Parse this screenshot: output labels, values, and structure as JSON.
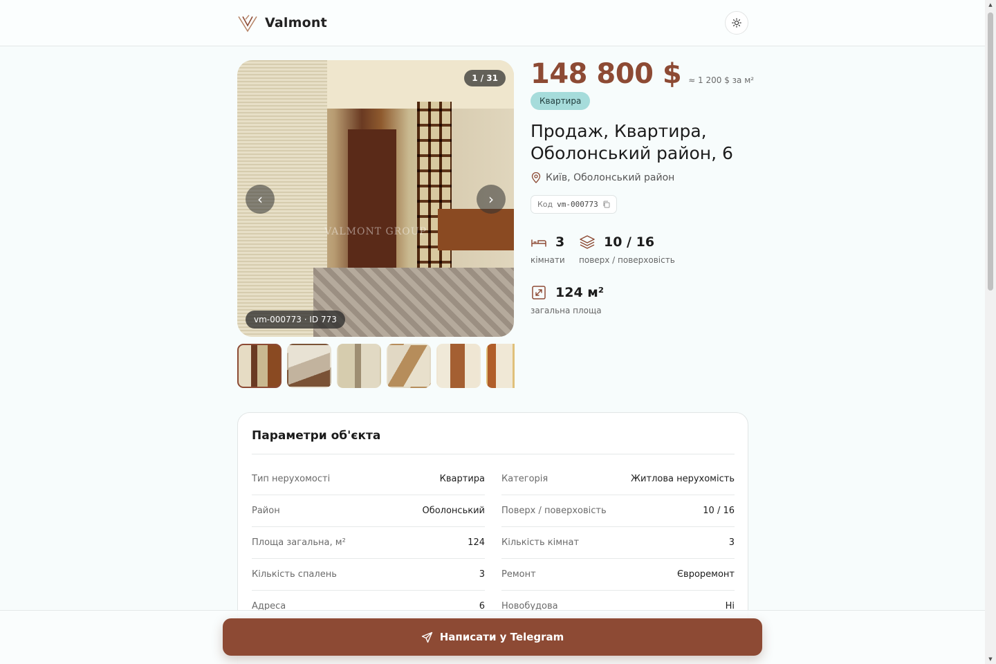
{
  "header": {
    "brand": "Valmont",
    "theme_toggle_icon": "sun-icon"
  },
  "gallery": {
    "counter": "1 / 31",
    "caption": "vm-000773 · ID 773",
    "watermark": "VALMONT GROUP",
    "prev_label": "‹",
    "next_label": "›",
    "thumbnail_count_visible": 6
  },
  "listing": {
    "price": "148 800 $",
    "price_per_m2": "≈ 1 200 $ за м²",
    "type_badge": "Квартира",
    "title": "Продаж, Квартира, Оболонський район, 6",
    "location": "Київ, Оболонський район",
    "code_label": "Код",
    "code_value": "vm-000773"
  },
  "stats": {
    "rooms": {
      "value": "3",
      "label": "кімнати",
      "icon": "bed-icon"
    },
    "floor": {
      "value": "10 / 16",
      "label": "поверх / поверховість",
      "icon": "layers-icon"
    },
    "area": {
      "value": "124 м²",
      "label": "загальна площа",
      "icon": "area-icon"
    }
  },
  "params": {
    "title": "Параметри об'єкта",
    "left": [
      {
        "key": "Тип нерухомості",
        "value": "Квартира"
      },
      {
        "key": "Район",
        "value": "Оболонський"
      },
      {
        "key": "Площа загальна, м²",
        "value": "124"
      },
      {
        "key": "Кількість спалень",
        "value": "3"
      },
      {
        "key": "Адреса",
        "value": "6"
      }
    ],
    "right": [
      {
        "key": "Категорія",
        "value": "Житлова нерухомість"
      },
      {
        "key": "Поверх / поверховість",
        "value": "10 / 16"
      },
      {
        "key": "Кількість кімнат",
        "value": "3"
      },
      {
        "key": "Ремонт",
        "value": "Євроремонт"
      },
      {
        "key": "Новобудова",
        "value": "Ні"
      }
    ]
  },
  "cta": {
    "label": "Написати у Telegram",
    "icon": "send-icon"
  },
  "colors": {
    "accent": "#8d4a34",
    "badge": "#a6dcdb",
    "background": "#f7fcfc"
  }
}
